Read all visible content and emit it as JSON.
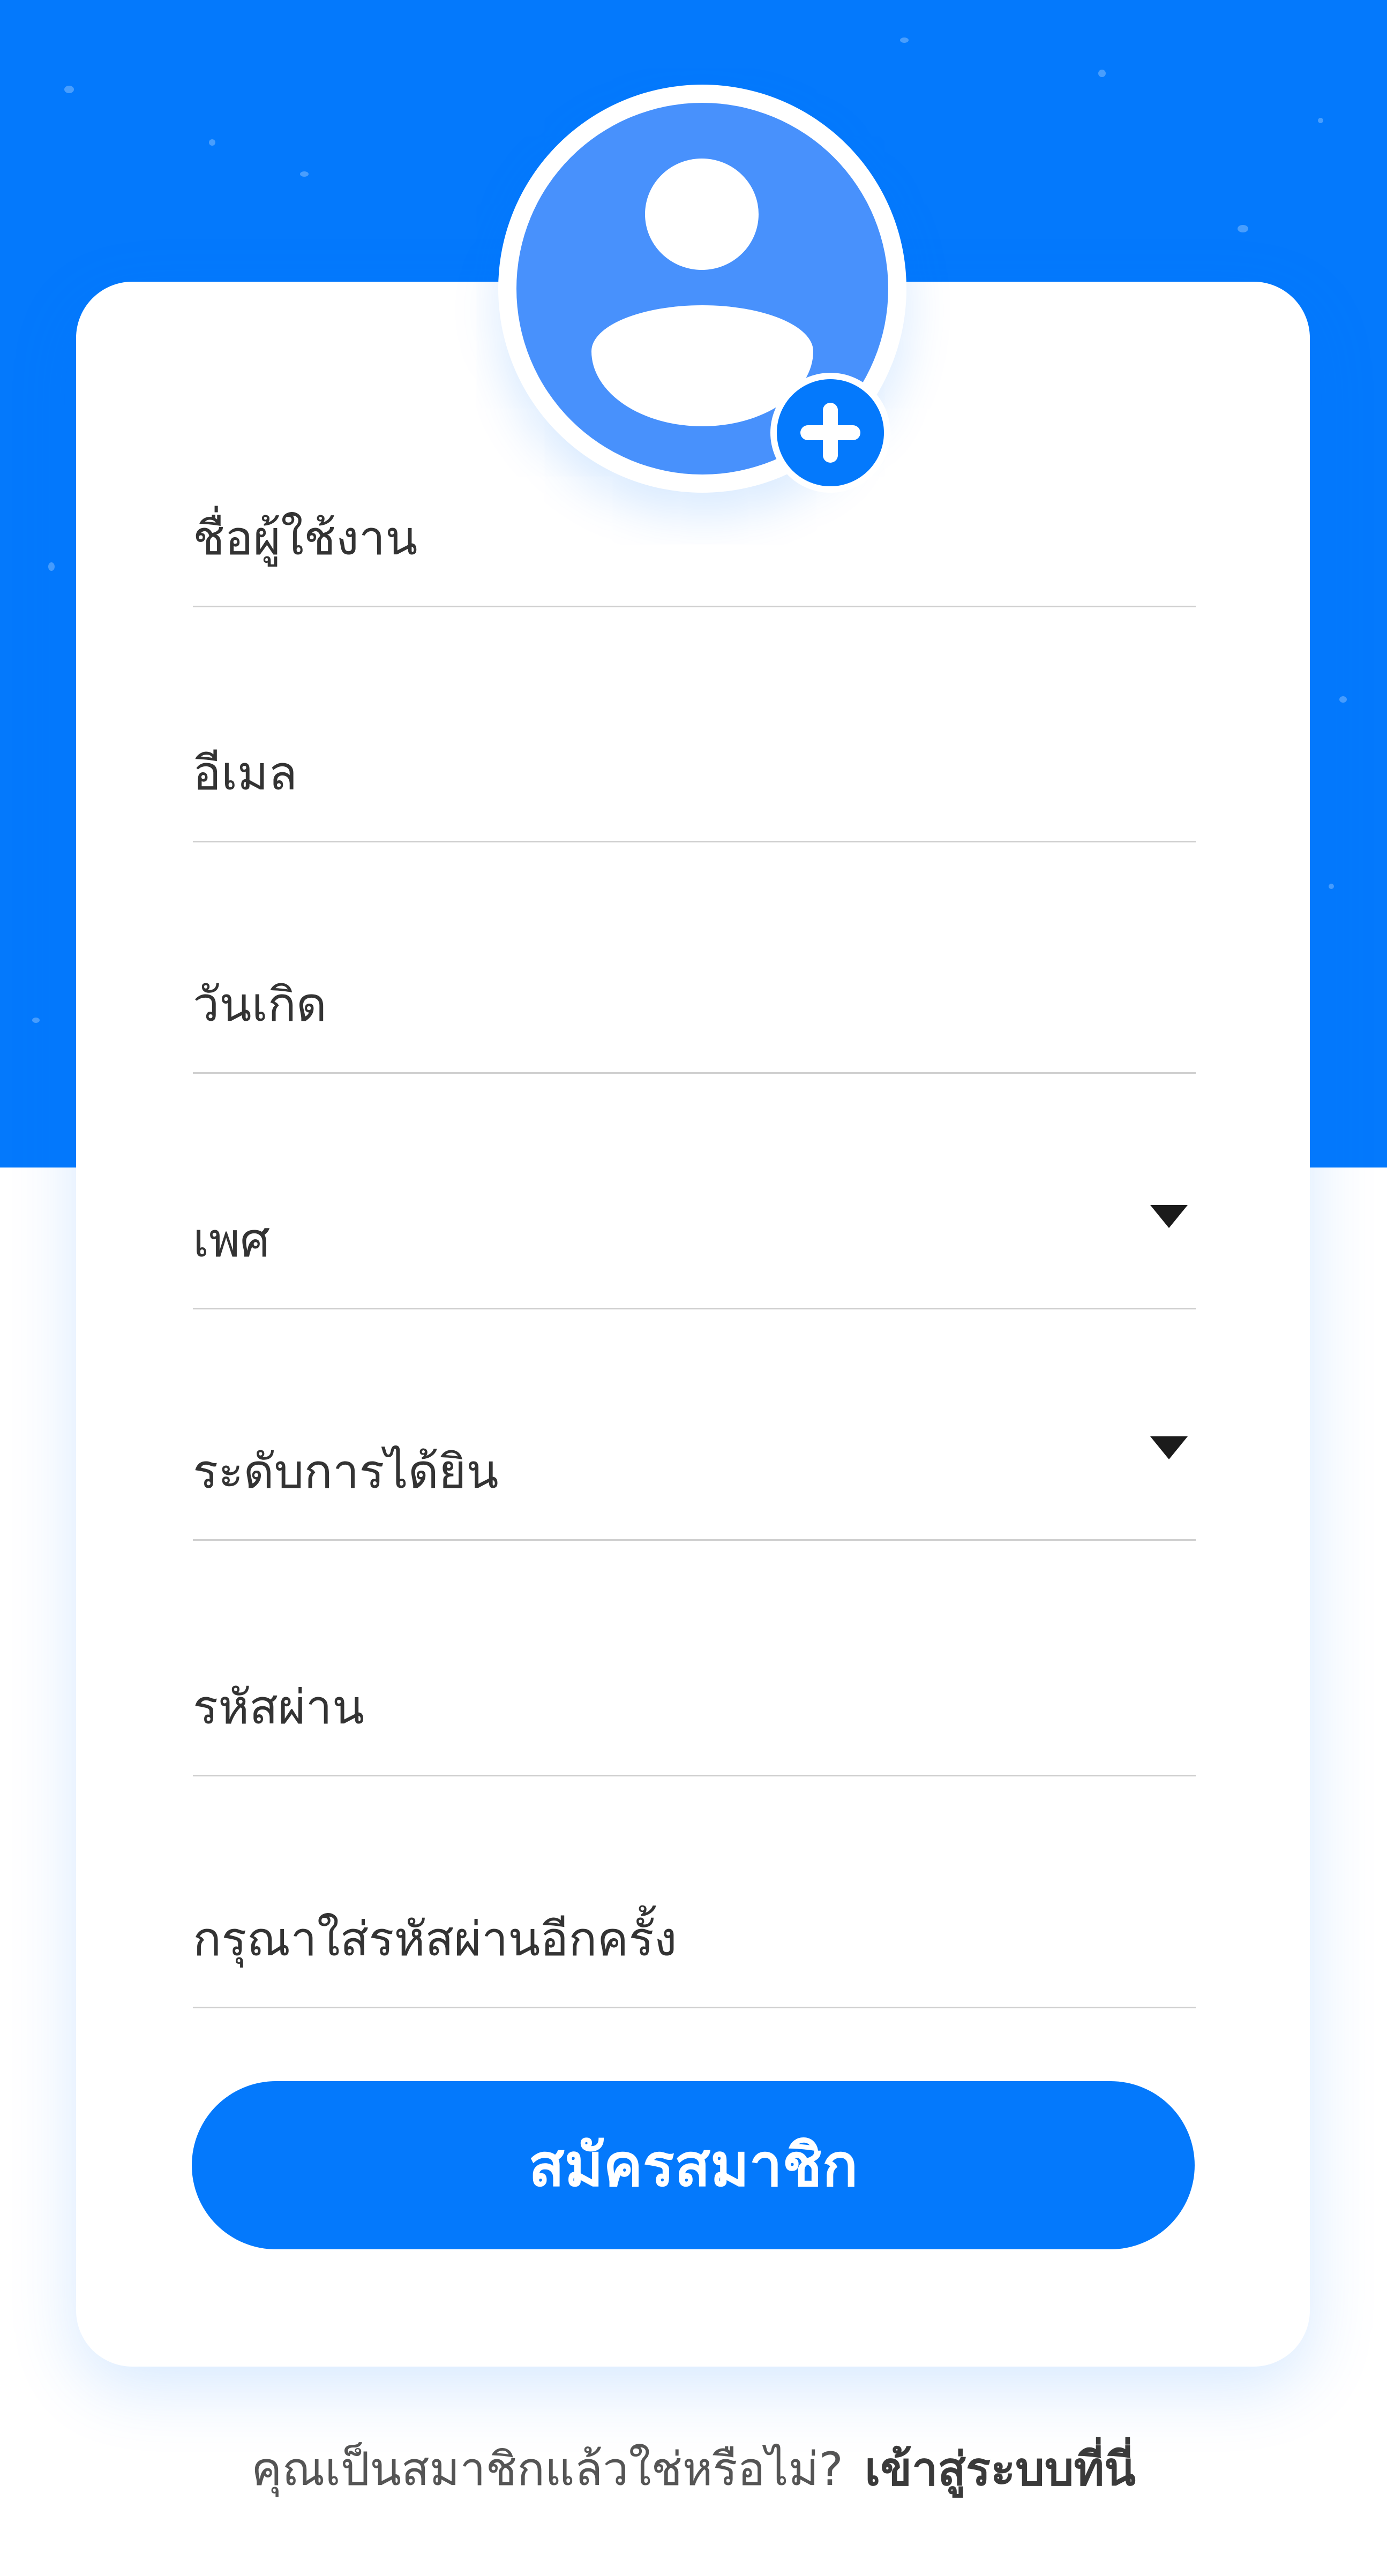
{
  "colors": {
    "accent": "#0479fc",
    "avatar_fill": "#4891fc",
    "card": "#ffffff",
    "divider": "#cfcfcf",
    "text": "#333333"
  },
  "avatar": {
    "icon": "user-icon",
    "add_icon": "plus-icon"
  },
  "form": {
    "fields": [
      {
        "label": "ชื่อผู้ใช้งาน",
        "type": "text"
      },
      {
        "label": "อีเมล",
        "type": "text"
      },
      {
        "label": "วันเกิด",
        "type": "text"
      },
      {
        "label": "เพศ",
        "type": "select",
        "icon": "caret-down-icon"
      },
      {
        "label": "ระดับการได้ยิน",
        "type": "select",
        "icon": "caret-down-icon"
      },
      {
        "label": "รหัสผ่าน",
        "type": "password"
      },
      {
        "label": "กรุณาใส่รหัสผ่านอีกครั้ง",
        "type": "password"
      }
    ],
    "submit_label": "สมัครสมาชิก"
  },
  "footer": {
    "prompt": "คุณเป็นสมาชิกแล้วใช่หรือไม่?",
    "link": "เข้าสู่ระบบที่นี่"
  }
}
